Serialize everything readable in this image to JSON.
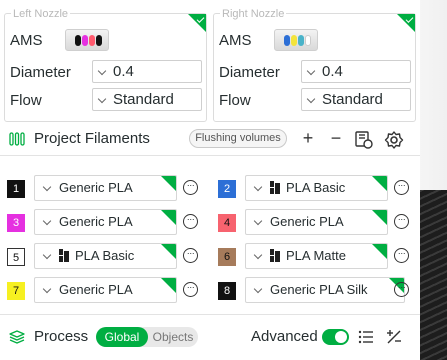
{
  "nozzles": {
    "left": {
      "title": "Left Nozzle",
      "ams_label": "AMS",
      "diameter_label": "Diameter",
      "diameter_value": "0.4",
      "flow_label": "Flow",
      "flow_value": "Standard",
      "slot_colors": [
        "#111111",
        "#e530e0",
        "#ff5a6e",
        "#111111"
      ]
    },
    "right": {
      "title": "Right Nozzle",
      "ams_label": "AMS",
      "diameter_label": "Diameter",
      "diameter_value": "0.4",
      "flow_label": "Flow",
      "flow_value": "Standard",
      "slot_colors": [
        "#2c6fd6",
        "#f3e43c",
        "#4ab3c9",
        "#ffffff"
      ]
    }
  },
  "project_filaments": {
    "title": "Project Filaments",
    "flushing_volumes_label": "Flushing volumes",
    "add_icon": "plus-icon",
    "remove_icon": "minus-icon",
    "settings_icon": "gear-icon",
    "filaments": [
      {
        "index": "1",
        "name": "Generic PLA",
        "color": "#111111",
        "text_color": "#ffffff",
        "bambu": false
      },
      {
        "index": "2",
        "name": "PLA Basic",
        "color": "#2c6fd6",
        "text_color": "#ffffff",
        "bambu": true
      },
      {
        "index": "3",
        "name": "Generic PLA",
        "color": "#e530e0",
        "text_color": "#ffffff",
        "bambu": false
      },
      {
        "index": "4",
        "name": "Generic PLA",
        "color": "#f7636f",
        "text_color": "#111111",
        "bambu": false
      },
      {
        "index": "5",
        "name": "PLA Basic",
        "color": "#ffffff",
        "text_color": "#111111",
        "bambu": true
      },
      {
        "index": "6",
        "name": "PLA Matte",
        "color": "#a67b5b",
        "text_color": "#111111",
        "bambu": true
      },
      {
        "index": "7",
        "name": "Generic PLA",
        "color": "#f6f021",
        "text_color": "#111111",
        "bambu": false
      },
      {
        "index": "8",
        "name": "Generic PLA Silk",
        "color": "#111111",
        "text_color": "#ffffff",
        "bambu": false
      }
    ]
  },
  "process": {
    "title": "Process",
    "global_label": "Global",
    "objects_label": "Objects",
    "advanced_label": "Advanced",
    "advanced_enabled": true
  },
  "colors": {
    "accent": "#00ae42"
  }
}
